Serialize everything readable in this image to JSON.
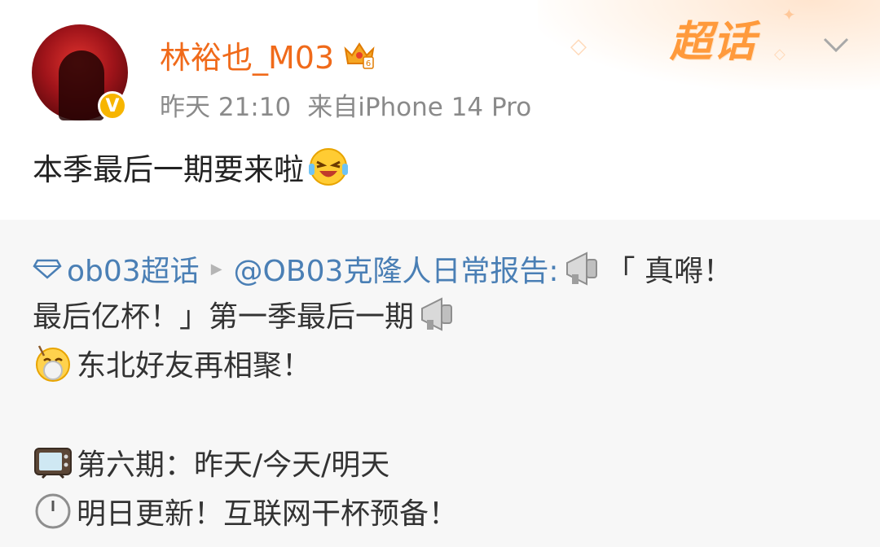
{
  "post": {
    "username": "林裕也_M03",
    "time": "昨天 21:10",
    "source": "来自iPhone 14 Pro",
    "text": "本季最后一期要来啦",
    "verified_mark": "V",
    "supertopic_badge": "超话"
  },
  "repost": {
    "topic_name": "ob03超话",
    "author": "@OB03克隆人日常报告:",
    "line1_tail": "「 真嘚！",
    "line2": "最后亿杯！」第一季最后一期",
    "line3": "东北好友再相聚！",
    "line4": "第六期：昨天/今天/明天",
    "line5": "明日更新！互联网干杯预备！"
  },
  "colors": {
    "username": "#f06a1a",
    "link": "#4a7fb5",
    "meta": "#8a8a8a",
    "badge": "#ff9a3c",
    "verified": "#f7b500"
  },
  "icons": [
    "crown-icon",
    "laughing-emoji-icon",
    "diamond-icon",
    "megaphone-icon",
    "drunk-emoji-icon",
    "tv-icon",
    "clock-icon",
    "chevron-down-icon",
    "verified-badge-icon"
  ]
}
